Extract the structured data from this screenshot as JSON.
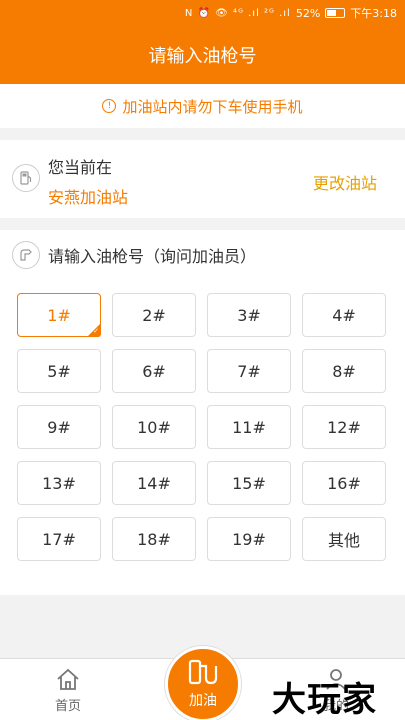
{
  "status_bar": {
    "icons": "N ⏰ 👁 ⁴ᴳ .ıl ²ᴳ .ıl",
    "battery": "52%",
    "time": "下午3:18"
  },
  "header": {
    "title": "请输入油枪号"
  },
  "notice": {
    "icon": "warning-icon",
    "text": "加油站内请勿下车使用手机"
  },
  "station": {
    "label": "您当前在",
    "name": "安燕加油站",
    "change_label": "更改油站"
  },
  "nozzle_section": {
    "title": "请输入油枪号（询问加油员）",
    "selected": "1#",
    "buttons": [
      "1#",
      "2#",
      "3#",
      "4#",
      "5#",
      "6#",
      "7#",
      "8#",
      "9#",
      "10#",
      "11#",
      "12#",
      "13#",
      "14#",
      "15#",
      "16#",
      "17#",
      "18#",
      "19#",
      "其他"
    ]
  },
  "tab_bar": {
    "home_label": "首页",
    "fuel_label": "加油",
    "mine_label": "我的"
  },
  "watermark": {
    "text": "大玩家"
  },
  "colors": {
    "accent": "#f57c00",
    "link": "#e6a100"
  }
}
